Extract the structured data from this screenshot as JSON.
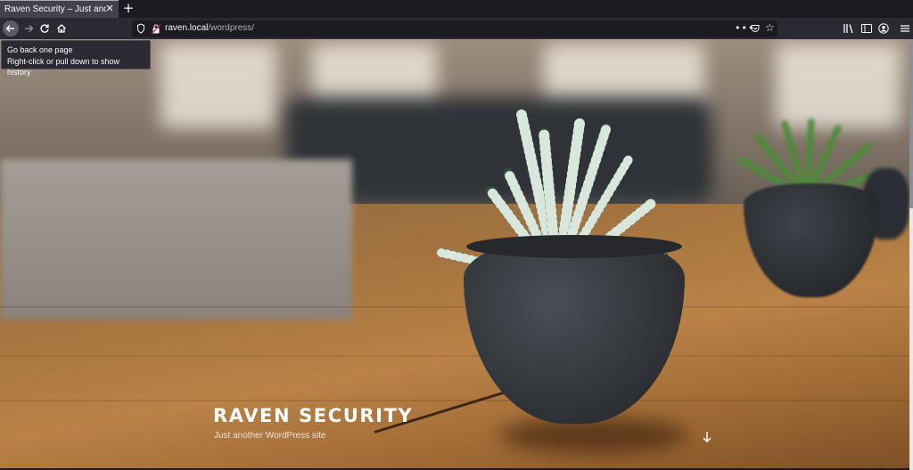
{
  "browser": {
    "tab": {
      "title": "Raven Security – Just another WordPress site",
      "close_icon": "close-icon"
    },
    "new_tab_icon": "plus-icon",
    "nav": {
      "back_icon": "arrow-left-icon",
      "forward_icon": "arrow-right-icon",
      "reload_icon": "reload-icon",
      "home_icon": "home-icon"
    },
    "url": {
      "host": "raven.local",
      "path": "/wordpress/"
    },
    "tooltip": {
      "line1": "Go back one page",
      "line2": "Right-click or pull down to show history"
    },
    "toolbar_icons": [
      "library-icon",
      "sidebar-icon",
      "account-icon",
      "menu-icon"
    ]
  },
  "hero": {
    "site_title": "RAVEN SECURITY",
    "tagline": "Just another WordPress site",
    "scroll_icon": "arrow-down-icon"
  },
  "colors": {
    "chrome_bg": "#1c1b22",
    "toolbar_bg": "#2b2a33",
    "tab_active": "#42414d",
    "text": "#fbfbfe"
  }
}
